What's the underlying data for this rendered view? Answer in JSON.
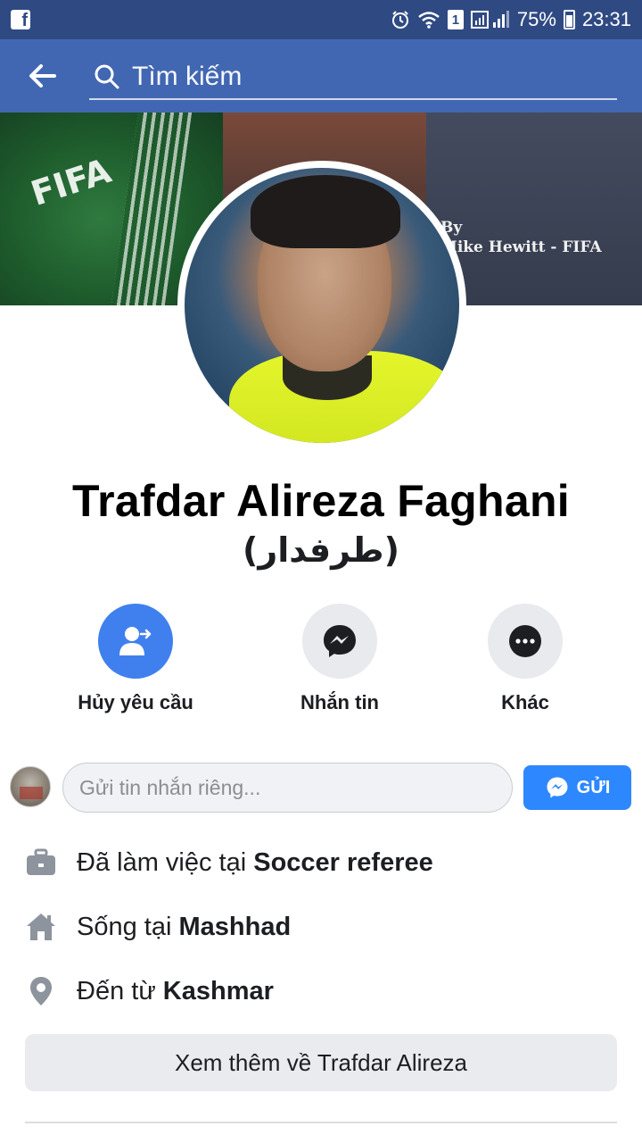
{
  "status_bar": {
    "battery": "75%",
    "time": "23:31",
    "sim_label": "1"
  },
  "header": {
    "search_placeholder": "Tìm kiếm"
  },
  "cover": {
    "credit_line1": "By",
    "credit_line2": "Mike Hewitt - FIFA",
    "shirt_text": "FIFA"
  },
  "profile": {
    "name": "Trafdar Alireza Faghani",
    "alternate_name": "(طرفدار)"
  },
  "actions": [
    {
      "label": "Hủy yêu cầu",
      "icon": "cancel-request-icon"
    },
    {
      "label": "Nhắn tin",
      "icon": "messenger-icon"
    },
    {
      "label": "Khác",
      "icon": "more-icon"
    }
  ],
  "message": {
    "placeholder": "Gửi tin nhắn riêng...",
    "send_label": "GỬI"
  },
  "info": {
    "work_prefix": "Đã làm việc tại ",
    "work_value": "Soccer referee",
    "lives_prefix": "Sống tại ",
    "lives_value": "Mashhad",
    "from_prefix": "Đến từ ",
    "from_value": "Kashmar"
  },
  "more_button": "Xem thêm về Trafdar Alireza",
  "colors": {
    "status_bar": "#2f4a83",
    "header": "#4267b2",
    "primary_action": "#4080ee",
    "send_button": "#2d88ff"
  }
}
